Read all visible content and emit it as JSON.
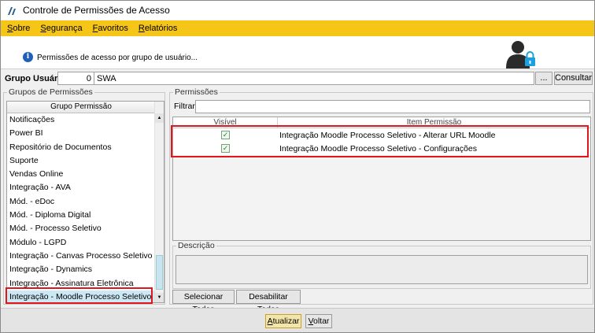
{
  "window": {
    "title": "Controle de Permissões de Acesso"
  },
  "menu": [
    "Sobre",
    "Segurança",
    "Favoritos",
    "Relatórios"
  ],
  "banner": {
    "info_text": "Permissões de acesso por grupo de usuário...",
    "icon": "user-lock-icon"
  },
  "group_user": {
    "label": "Grupo Usuário:",
    "code": "0",
    "name": "SWA",
    "browse_label": "...",
    "consult_label": "Consultar"
  },
  "groups_panel": {
    "legend": "Grupos de Permissões",
    "column_header": "Grupo Permissão",
    "items": [
      "Notificações",
      "Power BI",
      "Repositório de Documentos",
      "Suporte",
      "Vendas Online",
      "Integração - AVA",
      "Mód. - eDoc",
      "Mód. - Diploma Digital",
      "Mód. - Processo Seletivo",
      "Módulo - LGPD",
      "Integração - Canvas Processo Seletivo",
      "Integração - Dynamics",
      "Integração - Assinatura Eletrônica",
      "Integração - Moodle Processo Seletivo"
    ],
    "selected": "Integração - Moodle Processo Seletivo"
  },
  "permissions_panel": {
    "legend": "Permissões",
    "filter_label": "Filtrar:",
    "filter_value": "",
    "columns": [
      "Visível",
      "Item Permissão"
    ],
    "rows": [
      {
        "visible": true,
        "item": "Integração Moodle Processo Seletivo - Alterar URL Moodle"
      },
      {
        "visible": true,
        "item": "Integração Moodle Processo Seletivo - Configurações"
      }
    ],
    "description_legend": "Descrição",
    "select_all_label": "Selecionar Todos",
    "disable_all_label": "Desabilitar Todos"
  },
  "footer": {
    "update_label": "Atualizar",
    "back_label": "Voltar"
  },
  "colors": {
    "menubar": "#f5c518",
    "highlight": "#e0161b",
    "selected_row": "#cde8f5"
  }
}
